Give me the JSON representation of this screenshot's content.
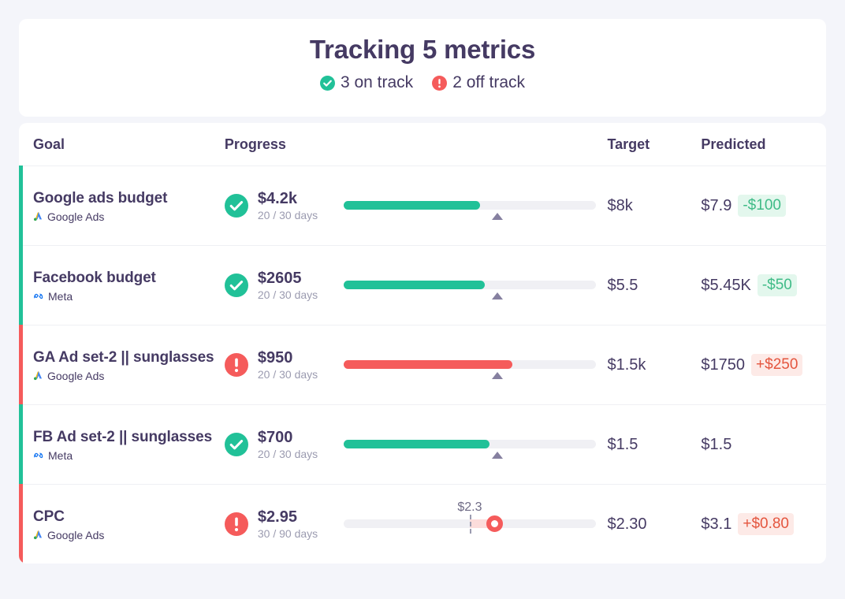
{
  "summary": {
    "title": "Tracking 5 metrics",
    "on_track": "3 on track",
    "off_track": "2 off track",
    "on_track_icon": "check-circle-icon",
    "off_track_icon": "alert-circle-icon"
  },
  "colors": {
    "green": "#21c198",
    "red": "#f55b5b",
    "text": "#453a63",
    "muted": "#9b9bb0",
    "track": "#f0f0f4",
    "badge_good_bg": "#e3f7ed",
    "badge_good_fg": "#3fbb87",
    "badge_bad_bg": "#fdeae7",
    "badge_bad_fg": "#e4553e",
    "page_bg": "#f4f5fa",
    "card_bg": "#ffffff"
  },
  "table": {
    "headers": {
      "goal": "Goal",
      "progress": "Progress",
      "target": "Target",
      "predicted": "Predicted"
    },
    "rows": [
      {
        "name": "Google ads budget",
        "source": "Google Ads",
        "source_icon": "google-ads-icon",
        "status": "on-track",
        "status_icon": "check-circle-icon",
        "amount": "$4.2k",
        "days": "20 / 30 days",
        "bar_style": "bar",
        "fill_pct": 54,
        "marker_pct": 61,
        "target": "$8k",
        "predicted": "$7.9",
        "delta": "-$100",
        "delta_kind": "good"
      },
      {
        "name": "Facebook budget",
        "source": "Meta",
        "source_icon": "meta-icon",
        "status": "on-track",
        "status_icon": "check-circle-icon",
        "amount": "$2605",
        "days": "20 / 30 days",
        "bar_style": "bar",
        "fill_pct": 56,
        "marker_pct": 61,
        "target": "$5.5",
        "predicted": "$5.45K",
        "delta": "-$50",
        "delta_kind": "good"
      },
      {
        "name": "GA Ad set-2 || sunglasses",
        "source": "Google Ads",
        "source_icon": "google-ads-icon",
        "status": "off-track",
        "status_icon": "alert-circle-icon",
        "amount": "$950",
        "days": "20 / 30 days",
        "bar_style": "bar",
        "fill_pct": 67,
        "marker_pct": 61,
        "target": "$1.5k",
        "predicted": "$1750",
        "delta": "+$250",
        "delta_kind": "bad"
      },
      {
        "name": "FB Ad set-2 || sunglasses",
        "source": "Meta",
        "source_icon": "meta-icon",
        "status": "on-track",
        "status_icon": "check-circle-icon",
        "amount": "$700",
        "days": "20 / 30 days",
        "bar_style": "bar",
        "fill_pct": 58,
        "marker_pct": 61,
        "target": "$1.5",
        "predicted": "$1.5",
        "delta": "",
        "delta_kind": "none"
      },
      {
        "name": "CPC",
        "source": "Google Ads",
        "source_icon": "google-ads-icon",
        "status": "off-track",
        "status_icon": "alert-circle-icon",
        "amount": "$2.95",
        "days": "30 / 90 days",
        "bar_style": "dot",
        "threshold_label": "$2.3",
        "threshold_pct": 50,
        "dot_pct": 60,
        "target": "$2.30",
        "predicted": "$3.1",
        "delta": "+$0.80",
        "delta_kind": "bad"
      }
    ]
  }
}
